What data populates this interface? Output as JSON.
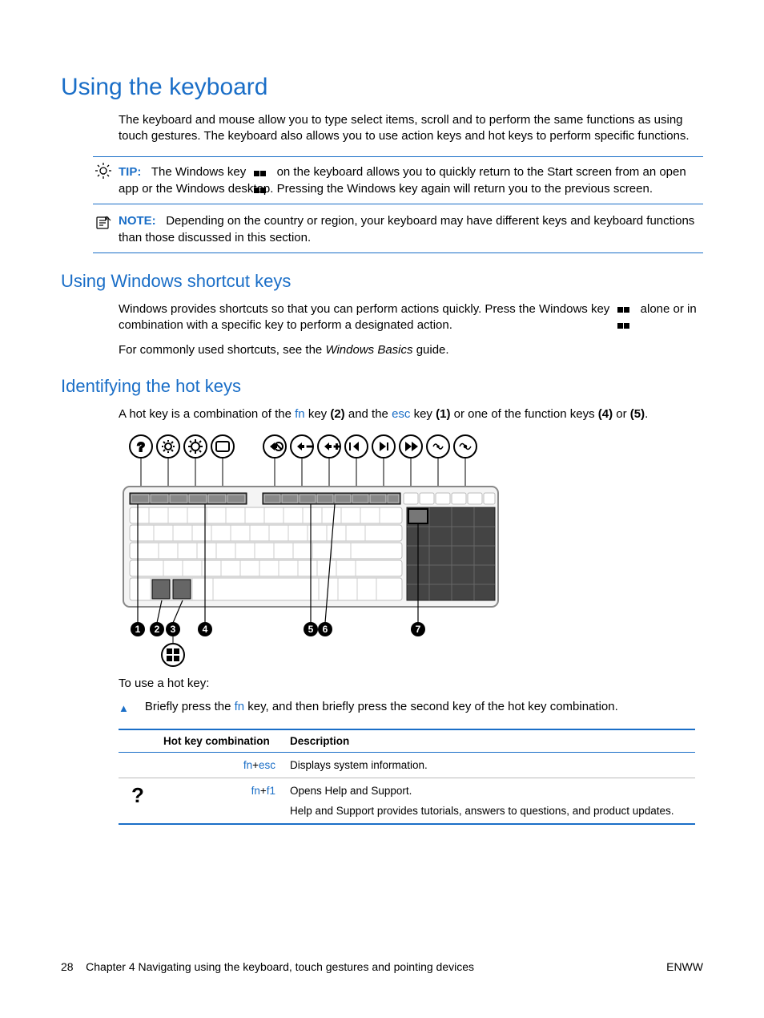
{
  "title": "Using the keyboard",
  "intro": "The keyboard and mouse allow you to type select items, scroll and to perform the same functions as using touch gestures. The keyboard also allows you to use action keys and hot keys to perform specific functions.",
  "tip": {
    "label": "TIP:",
    "before_icon": "The Windows key",
    "after_icon": "on the keyboard allows you to quickly return to the Start screen from an open app or the Windows desktop. Pressing the Windows key again will return you to the previous screen."
  },
  "note": {
    "label": "NOTE:",
    "text": "Depending on the country or region, your keyboard may have different keys and keyboard functions than those discussed in this section."
  },
  "section_shortcut": {
    "title": "Using Windows shortcut keys",
    "p1_before": "Windows provides shortcuts so that you can perform actions quickly. Press the Windows key",
    "p1_after": "alone or in combination with a specific key to perform a designated action.",
    "p2_before": "For commonly used shortcuts, see the ",
    "p2_italic": "Windows Basics",
    "p2_after": " guide."
  },
  "section_hotkeys": {
    "title": "Identifying the hot keys",
    "sentence": {
      "a": "A hot key is a combination of the ",
      "fn": "fn",
      "b": " key ",
      "two": "(2)",
      "c": " and the ",
      "esc": "esc",
      "d": " key ",
      "one": "(1)",
      "e": " or one of the function keys ",
      "four": "(4)",
      "f": " or ",
      "five": "(5)",
      "g": "."
    },
    "to_use": "To use a hot key:",
    "bullet_before": "Briefly press the ",
    "bullet_fn": "fn",
    "bullet_after": " key, and then briefly press the second key of the hot key combination."
  },
  "table": {
    "h1": "Hot key combination",
    "h2": "Description",
    "rows": [
      {
        "icon": "",
        "combo_a": "fn",
        "combo_plus": "+",
        "combo_b": "esc",
        "desc1": "Displays system information.",
        "desc2": ""
      },
      {
        "icon": "?",
        "combo_a": "fn",
        "combo_plus": "+",
        "combo_b": "f1",
        "desc1": "Opens Help and Support.",
        "desc2": "Help and Support provides tutorials, answers to questions, and product updates."
      }
    ]
  },
  "footer": {
    "page": "28",
    "chapter": "Chapter 4   Navigating using the keyboard, touch gestures and pointing devices",
    "right": "ENWW"
  }
}
